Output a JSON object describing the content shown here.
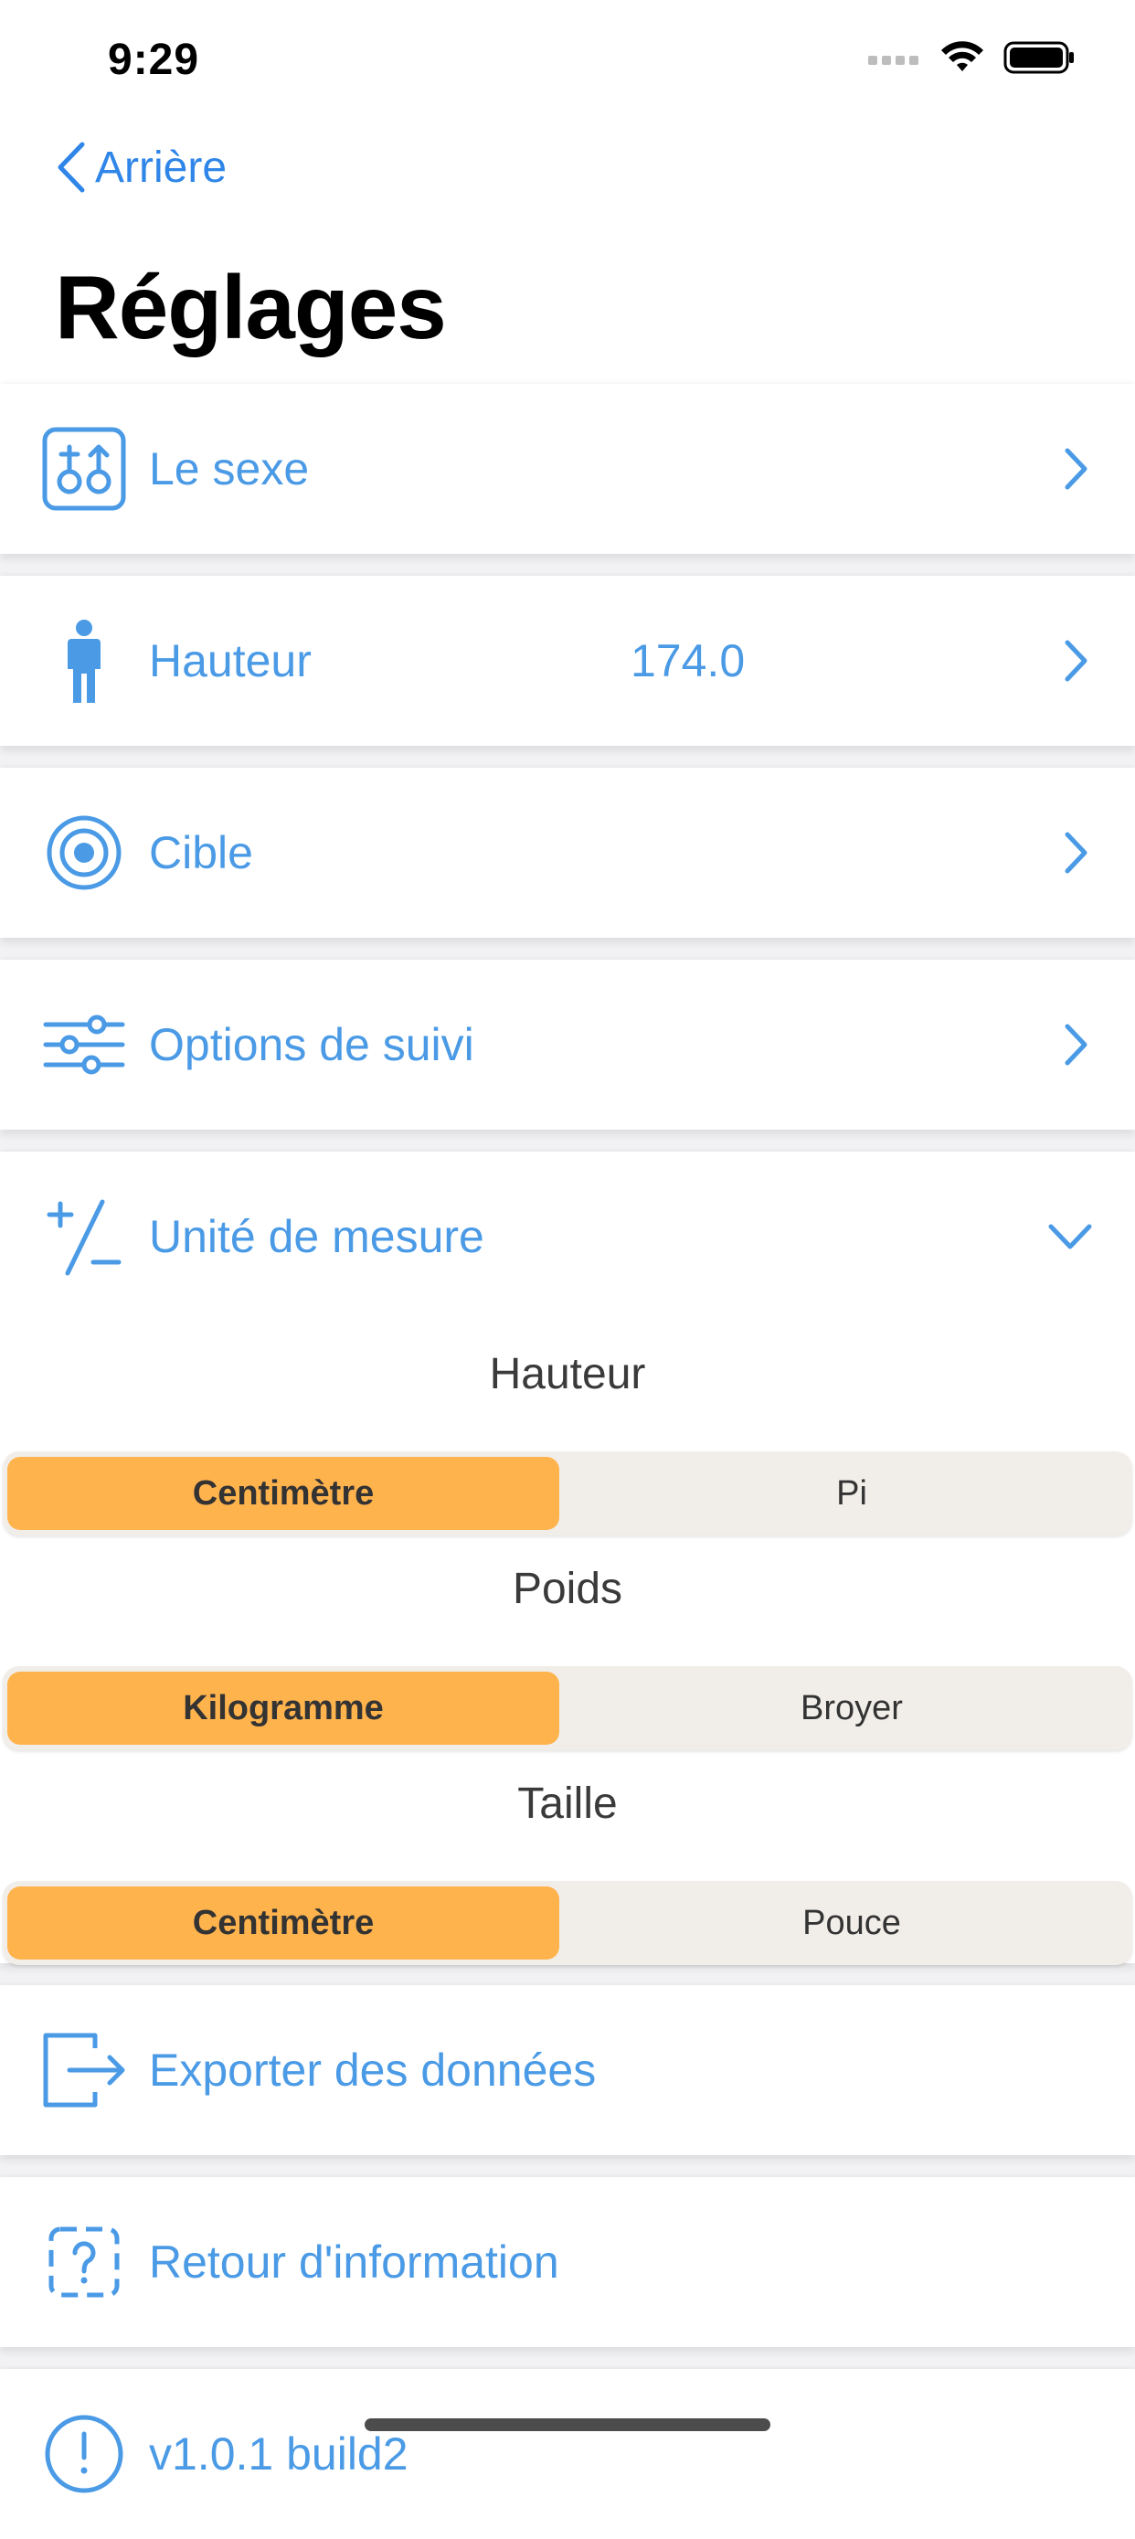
{
  "status_bar": {
    "time": "9:29"
  },
  "nav": {
    "back_label": "Arrière",
    "title": "Réglages"
  },
  "rows": {
    "sex": {
      "label": "Le sexe",
      "icon": "gender-icon"
    },
    "height": {
      "label": "Hauteur",
      "value": "174.0",
      "icon": "person-icon"
    },
    "target": {
      "label": "Cible",
      "icon": "target-icon"
    },
    "tracking": {
      "label": "Options de suivi",
      "icon": "sliders-icon"
    },
    "units": {
      "label": "Unité de mesure",
      "icon": "plus-minus-icon"
    },
    "export": {
      "label": "Exporter des données",
      "icon": "export-icon"
    },
    "feedback": {
      "label": "Retour d'information",
      "icon": "question-icon"
    },
    "version": {
      "label": "v1.0.1 build2",
      "icon": "info-icon"
    }
  },
  "units": {
    "height": {
      "title": "Hauteur",
      "options": [
        "Centimètre",
        "Pi"
      ],
      "selected": "Centimètre"
    },
    "weight": {
      "title": "Poids",
      "options": [
        "Kilogramme",
        "Broyer"
      ],
      "selected": "Kilogramme"
    },
    "waist": {
      "title": "Taille",
      "options": [
        "Centimètre",
        "Pouce"
      ],
      "selected": "Centimètre"
    }
  },
  "colors": {
    "accent": "#4a9ae6",
    "selected_segment": "#ffb34d",
    "segment_bg": "#f1eee9"
  }
}
